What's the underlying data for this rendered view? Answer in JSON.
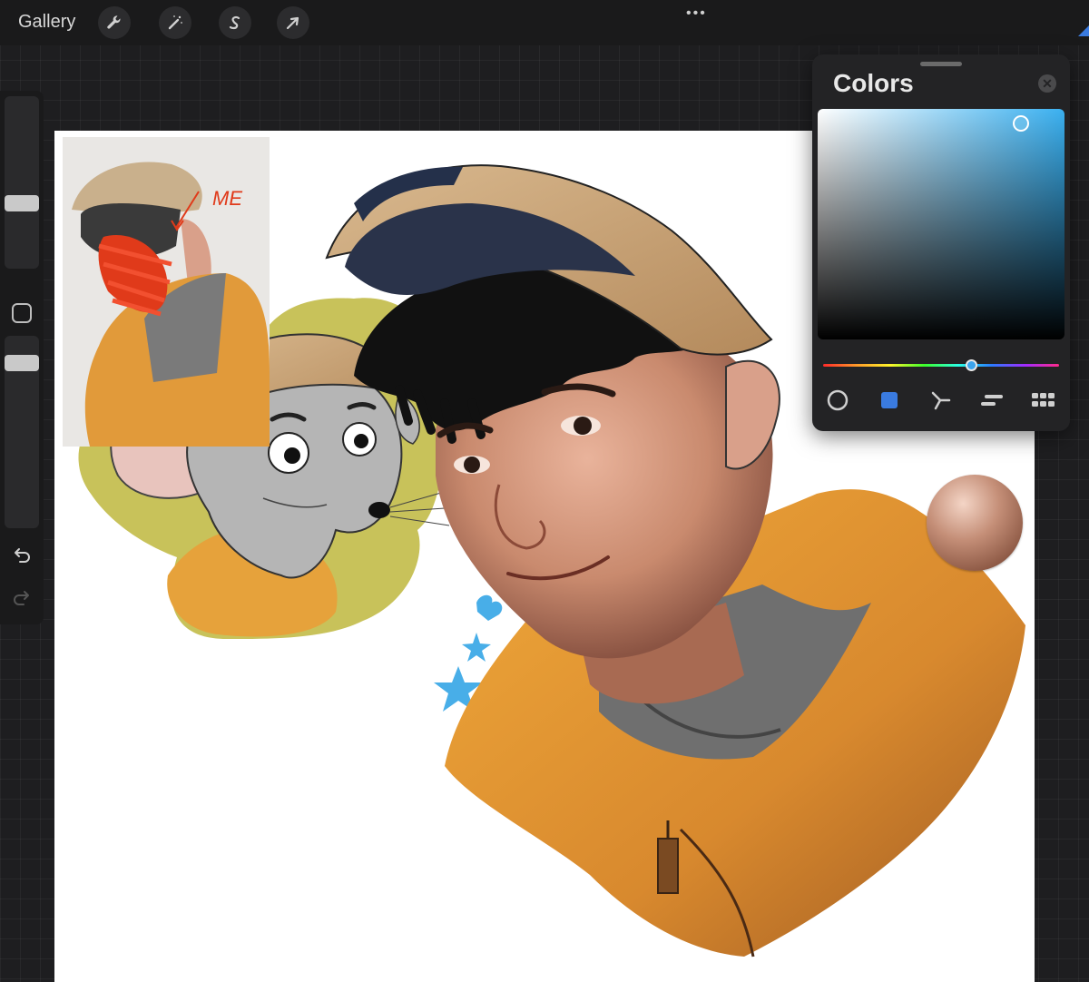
{
  "toolbar": {
    "gallery_label": "Gallery",
    "tools": [
      {
        "icon": "wrench-icon",
        "name": "actions"
      },
      {
        "icon": "magic-wand-icon",
        "name": "adjustments"
      },
      {
        "icon": "selection-s-icon",
        "name": "selection"
      },
      {
        "icon": "arrow-cursor-icon",
        "name": "transform"
      }
    ],
    "more_label": "•••"
  },
  "colors_panel": {
    "title": "Colors",
    "close_glyph": "✕",
    "current_color": "#3aa4ee",
    "hue_position": 0.6,
    "modes": [
      {
        "icon": "disc-icon",
        "name": "disc"
      },
      {
        "icon": "classic-square-icon",
        "name": "classic",
        "active": true
      },
      {
        "icon": "harmony-icon",
        "name": "harmony"
      },
      {
        "icon": "value-bars-icon",
        "name": "value"
      },
      {
        "icon": "palettes-grid-icon",
        "name": "palettes"
      }
    ]
  },
  "artwork": {
    "annotation_text": "ME",
    "skin_swatch_color": "#c58f78",
    "hoodie_color": "#e19a3a",
    "cap_color": "#c9a57a",
    "sticker_outline_color": "#c8c25a",
    "doodle_color": "#48aee8",
    "scribble_color": "#e03a1a"
  }
}
